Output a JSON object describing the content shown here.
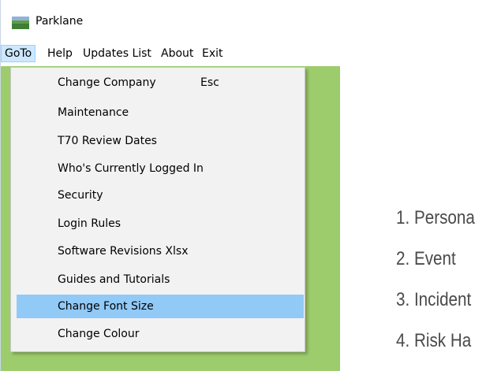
{
  "window": {
    "title": "Parklane",
    "icon": "parklane-app-icon"
  },
  "menubar": {
    "items": [
      {
        "label": "GoTo",
        "active": true
      },
      {
        "label": "Help"
      },
      {
        "label": "Updates List"
      },
      {
        "label": "About"
      },
      {
        "label": "Exit"
      }
    ]
  },
  "goto_menu": {
    "items": [
      {
        "label": "Change Company",
        "shortcut": "Esc"
      },
      {
        "label": "Maintenance"
      },
      {
        "label": "T70 Review Dates"
      },
      {
        "label": "Who's Currently Logged In"
      },
      {
        "label": "Security"
      },
      {
        "label": "Login Rules"
      },
      {
        "label": "Software Revisions Xlsx"
      },
      {
        "label": "Guides and Tutorials"
      },
      {
        "label": "Change Font Size",
        "highlighted": true
      },
      {
        "label": "Change Colour"
      }
    ]
  },
  "content": {
    "lines": [
      "1. Persona",
      "2. Event",
      "3. Incident",
      "4. Risk Ha"
    ]
  },
  "colors": {
    "panel_green": "#9ccc6b",
    "menu_highlight": "#91c9f7",
    "menubar_active": "#cce8ff"
  }
}
